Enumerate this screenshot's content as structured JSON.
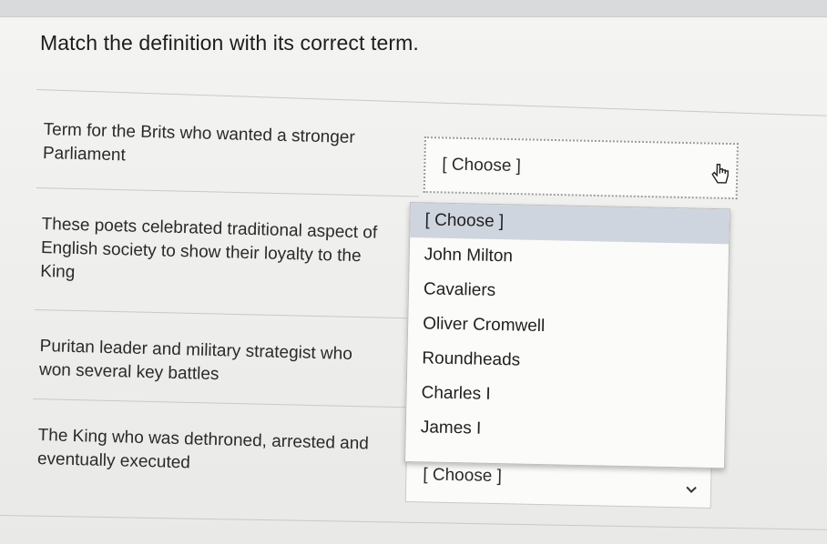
{
  "question": "Match the definition with its correct term.",
  "items": [
    {
      "definition": "Term for the Brits who wanted a stronger Parliament",
      "line1": "Term for the Brits who wanted a stronger",
      "line2": "Parliament",
      "selected": "[ Choose ]"
    },
    {
      "definition": "These poets celebrated traditional aspect of English society to show their loyalty to the King",
      "line1": "These poets celebrated traditional aspect of",
      "line2": "English society to show their loyalty to the",
      "line3": "King"
    },
    {
      "definition": "Puritan leader and military strategist who won several key battles",
      "line1": "Puritan leader and military strategist who",
      "line2": "won several key battles"
    },
    {
      "definition": "The King who was dethroned, arrested and eventually executed",
      "line1": "The King who was dethroned, arrested and",
      "line2": "eventually executed",
      "selected": "[ Choose ]"
    }
  ],
  "dropdown": {
    "options": [
      "[ Choose ]",
      "John Milton",
      "Cavaliers",
      "Oliver Cromwell",
      "Roundheads",
      "Charles I",
      "James I"
    ],
    "highlighted_index": 0
  },
  "colors": {
    "highlight": "#cfd5de",
    "background": "#efefed"
  },
  "icons": {
    "cursor": "hand-pointer-icon",
    "chevron": "chevron-down-icon"
  }
}
